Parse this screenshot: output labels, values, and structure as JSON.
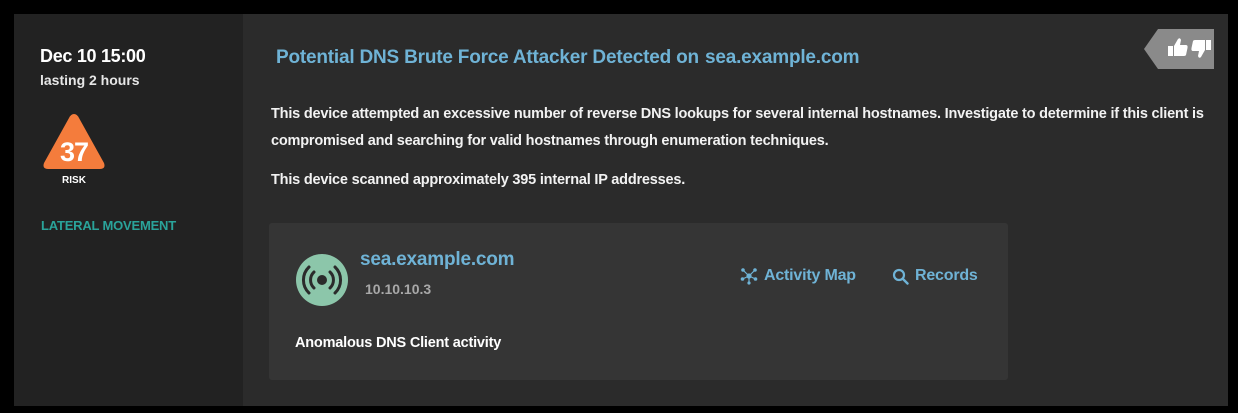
{
  "detection": {
    "date": "Dec 10 15:00",
    "duration": "lasting 2 hours",
    "risk_score": "37",
    "risk_label": "RISK",
    "category": "LATERAL MOVEMENT",
    "title_prefix": "Potential DNS Brute Force Attacker Detected on",
    "title_host": "sea.example.com",
    "description": "This device attempted an excessive number of reverse DNS lookups for several internal hostnames. Investigate to determine if this client is compromised and searching for valid hostnames through enumeration techniques.",
    "scan_note": "This device scanned approximately 395 internal IP addresses."
  },
  "device": {
    "name": "sea.example.com",
    "ip": "10.10.10.3",
    "activity_map_label": "Activity Map",
    "records_label": "Records",
    "activity": "Anomalous DNS Client activity"
  },
  "icons": {
    "risk": "triangle-warning-icon",
    "feedback_up": "thumbs-up-icon",
    "feedback_down": "thumbs-down-icon",
    "device": "dns-client-icon",
    "activity_map": "network-map-icon",
    "records": "search-icon"
  },
  "colors": {
    "page_background": "#000000",
    "card_background": "#2b2b2b",
    "sidebar_background": "#222222",
    "device_card_background": "#353535",
    "link": "#6fb3d6",
    "category": "#2aa39a",
    "risk": "#f47c3c",
    "feedback_tag": "#8a8a8a",
    "device_icon": "#8cc6aa"
  }
}
